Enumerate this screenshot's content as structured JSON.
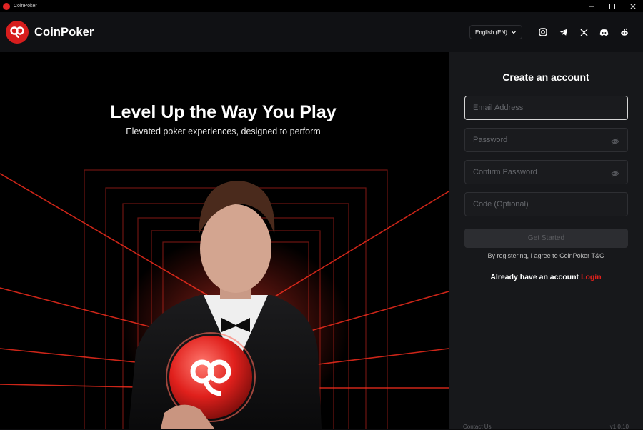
{
  "titlebar": {
    "title": "CoinPoker"
  },
  "header": {
    "brand": "CoinPoker",
    "language": "English (EN)",
    "socials": [
      "instagram-icon",
      "telegram-icon",
      "x-icon",
      "discord-icon",
      "reddit-icon"
    ]
  },
  "hero": {
    "title": "Level Up the Way You Play",
    "subtitle": "Elevated poker experiences, designed to perform"
  },
  "form": {
    "title": "Create an account",
    "email_placeholder": "Email Address",
    "password_placeholder": "Password",
    "confirm_placeholder": "Confirm Password",
    "code_placeholder": "Code (Optional)",
    "submit_label": "Get Started",
    "terms": "By registering, I agree to CoinPoker T&C",
    "have_account": "Already have an account",
    "login_label": "Login"
  },
  "footer": {
    "contact": "Contact Us",
    "version": "v1.0.10"
  },
  "colors": {
    "accent": "#e0201c",
    "panel_bg": "#17181b",
    "header_bg": "#101114"
  }
}
